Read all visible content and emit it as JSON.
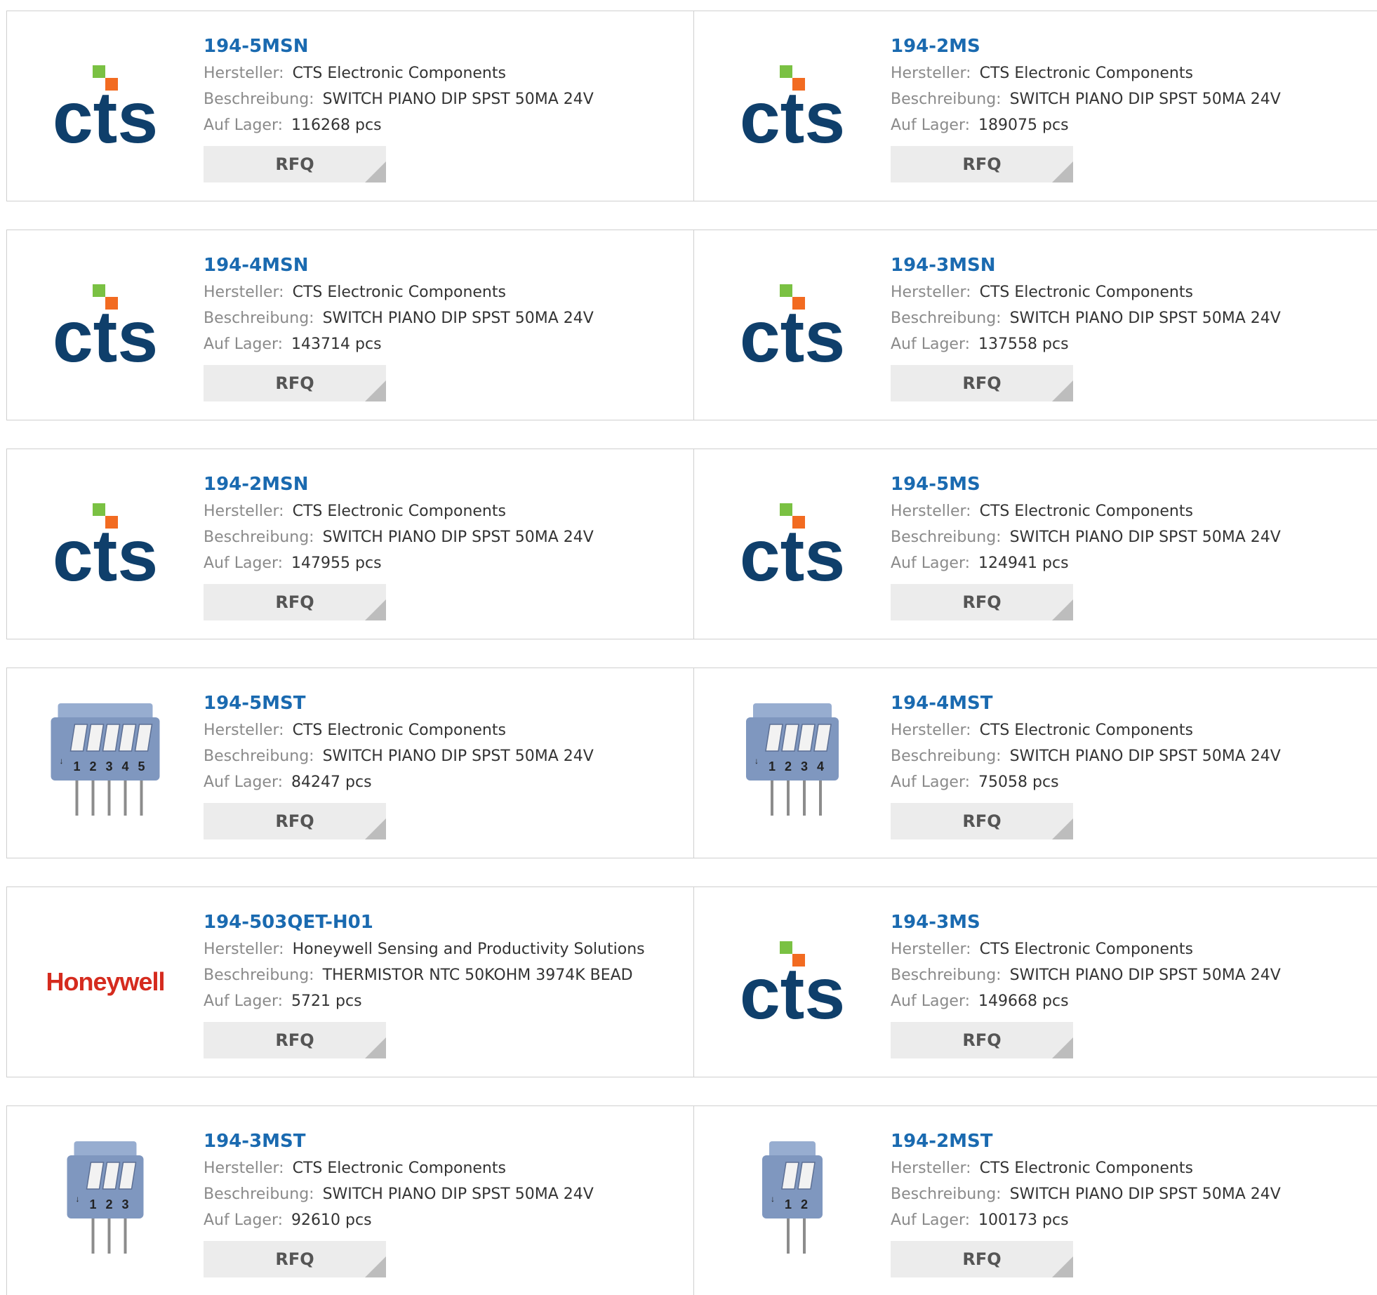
{
  "labels": {
    "manufacturer": "Hersteller:",
    "description": "Beschreibung:",
    "stock": "Auf Lager:",
    "rfq": "RFQ"
  },
  "colors": {
    "part_link": "#1a6ab0",
    "cts_blue": "#0f3f6b",
    "cts_green": "#7ac143",
    "cts_orange": "#f26b21",
    "honeywell_red": "#d52b1e",
    "switch_body": "#7f97bf"
  },
  "products": [
    {
      "part": "194-5MSN",
      "manufacturer": "CTS Electronic Components",
      "description": "SWITCH PIANO DIP SPST 50MA 24V",
      "stock": "116268 pcs",
      "image": "cts-logo"
    },
    {
      "part": "194-2MS",
      "manufacturer": "CTS Electronic Components",
      "description": "SWITCH PIANO DIP SPST 50MA 24V",
      "stock": "189075 pcs",
      "image": "cts-logo"
    },
    {
      "part": "194-4MSN",
      "manufacturer": "CTS Electronic Components",
      "description": "SWITCH PIANO DIP SPST 50MA 24V",
      "stock": "143714 pcs",
      "image": "cts-logo"
    },
    {
      "part": "194-3MSN",
      "manufacturer": "CTS Electronic Components",
      "description": "SWITCH PIANO DIP SPST 50MA 24V",
      "stock": "137558 pcs",
      "image": "cts-logo"
    },
    {
      "part": "194-2MSN",
      "manufacturer": "CTS Electronic Components",
      "description": "SWITCH PIANO DIP SPST 50MA 24V",
      "stock": "147955 pcs",
      "image": "cts-logo"
    },
    {
      "part": "194-5MS",
      "manufacturer": "CTS Electronic Components",
      "description": "SWITCH PIANO DIP SPST 50MA 24V",
      "stock": "124941 pcs",
      "image": "cts-logo"
    },
    {
      "part": "194-5MST",
      "manufacturer": "CTS Electronic Components",
      "description": "SWITCH PIANO DIP SPST 50MA 24V",
      "stock": "84247 pcs",
      "image": "dip-switch-photo",
      "switch_labels": [
        "1",
        "2",
        "3",
        "4",
        "5"
      ]
    },
    {
      "part": "194-4MST",
      "manufacturer": "CTS Electronic Components",
      "description": "SWITCH PIANO DIP SPST 50MA 24V",
      "stock": "75058 pcs",
      "image": "dip-switch-photo",
      "switch_labels": [
        "1",
        "2",
        "3",
        "4"
      ]
    },
    {
      "part": "194-503QET-H01",
      "manufacturer": "Honeywell Sensing and Productivity Solutions",
      "description": "THERMISTOR NTC 50KOHM 3974K BEAD",
      "stock": "5721 pcs",
      "image": "honeywell-logo",
      "logo_text": "Honeywell"
    },
    {
      "part": "194-3MS",
      "manufacturer": "CTS Electronic Components",
      "description": "SWITCH PIANO DIP SPST 50MA 24V",
      "stock": "149668 pcs",
      "image": "cts-logo"
    },
    {
      "part": "194-3MST",
      "manufacturer": "CTS Electronic Components",
      "description": "SWITCH PIANO DIP SPST 50MA 24V",
      "stock": "92610 pcs",
      "image": "dip-switch-photo",
      "switch_labels": [
        "1",
        "2",
        "3"
      ]
    },
    {
      "part": "194-2MST",
      "manufacturer": "CTS Electronic Components",
      "description": "SWITCH PIANO DIP SPST 50MA 24V",
      "stock": "100173 pcs",
      "image": "dip-switch-photo",
      "switch_labels": [
        "1",
        "2"
      ]
    }
  ]
}
